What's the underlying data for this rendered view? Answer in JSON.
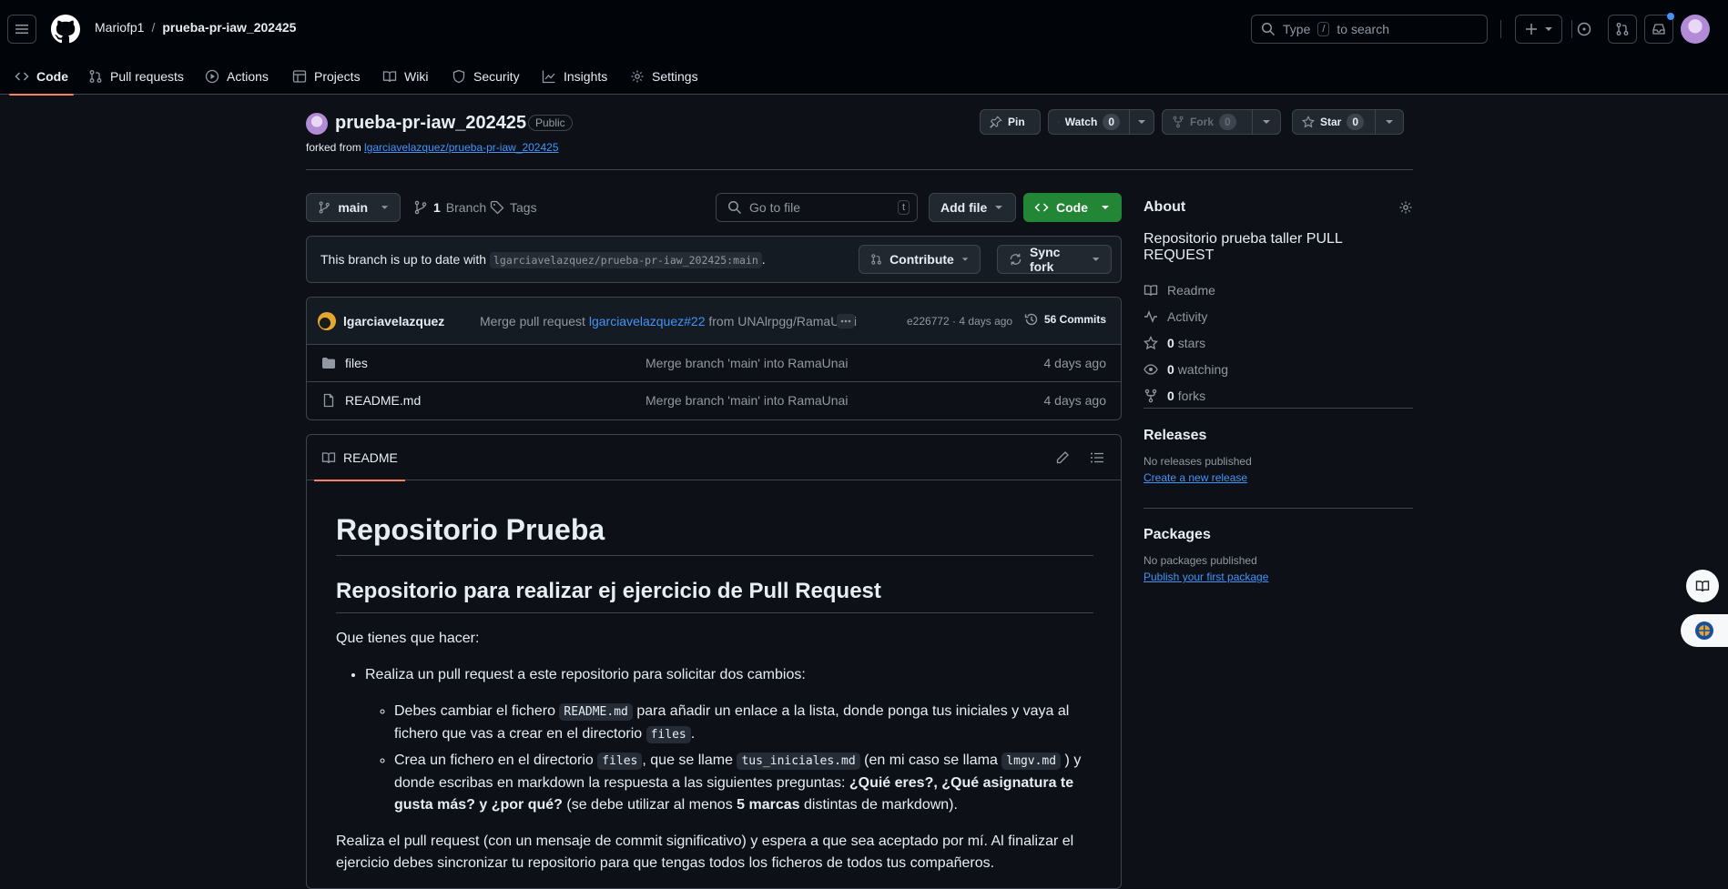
{
  "header": {
    "owner": "Mariofp1",
    "separator": "/",
    "repo": "prueba-pr-iaw_202425",
    "search_prefix": "Type",
    "search_key": "/",
    "search_suffix": "to search"
  },
  "nav": {
    "tabs": [
      {
        "label": "Code"
      },
      {
        "label": "Pull requests"
      },
      {
        "label": "Actions"
      },
      {
        "label": "Projects"
      },
      {
        "label": "Wiki"
      },
      {
        "label": "Security"
      },
      {
        "label": "Insights"
      },
      {
        "label": "Settings"
      }
    ]
  },
  "repo": {
    "title": "prueba-pr-iaw_202425",
    "visibility": "Public",
    "forked_prefix": "forked from",
    "forked_link": "lgarciavelazquez/prueba-pr-iaw_202425",
    "pin_label": "Pin",
    "watch_label": "Watch",
    "watch_count": "0",
    "fork_label": "Fork",
    "fork_count": "0",
    "star_label": "Star",
    "star_count": "0"
  },
  "filebar": {
    "branch": "main",
    "branch_count": "1",
    "branch_label": "Branch",
    "tags_label": "Tags",
    "goto_placeholder": "Go to file",
    "goto_key": "t",
    "add_file": "Add file",
    "code": "Code"
  },
  "uptodate": {
    "text": "This branch is up to date with",
    "ref": "lgarciavelazquez/prueba-pr-iaw_202425:main",
    "period": ".",
    "contribute": "Contribute",
    "sync": "Sync fork"
  },
  "commit": {
    "author": "lgarciavelazquez",
    "message_prefix": "Merge pull request",
    "pr_link": "lgarciavelazquez#22",
    "message_suffix": "from UNAlrpgg/RamaUnai",
    "hash_time": "e226772 · 4 days ago",
    "commits": "56 Commits"
  },
  "files": [
    {
      "name": "files",
      "message": "Merge branch 'main' into RamaUnai",
      "time": "4 days ago"
    },
    {
      "name": "README.md",
      "message": "Merge branch 'main' into RamaUnai",
      "time": "4 days ago"
    }
  ],
  "readme": {
    "tab": "README",
    "h1": "Repositorio Prueba",
    "h2": "Repositorio para realizar ej ejercicio de Pull Request",
    "intro": "Que tienes que hacer:",
    "bullet1": "Realiza un pull request a este repositorio para solicitar dos cambios:",
    "sub1_a": "Debes cambiar el fichero",
    "sub1_code1": "README.md",
    "sub1_b": "para añadir un enlace a la lista, donde ponga tus iniciales y vaya al fichero que vas a crear en el directorio",
    "sub1_code2": "files",
    "sub1_c": ".",
    "sub2_a": "Crea un fichero en el directorio",
    "sub2_code1": "files",
    "sub2_b": ", que se llame",
    "sub2_code2": "tus_iniciales.md",
    "sub2_c": "(en mi caso se llama",
    "sub2_code3": "lmgv.md",
    "sub2_d": ") y donde escribas en markdown la respuesta a las siguientes preguntas:",
    "sub2_bold1": "¿Quié eres?, ¿Qué asignatura te gusta más? y ¿por qué?",
    "sub2_e": "(se debe utilizar al menos",
    "sub2_bold2": "5 marcas",
    "sub2_f": "distintas de markdown).",
    "final": "Realiza el pull request (con un mensaje de commit significativo) y espera a que sea aceptado por mí. Al finalizar el ejercicio debes sincronizar tu repositorio para que tengas todos los ficheros de todos tus compañeros."
  },
  "sidebar": {
    "about": "About",
    "description": "Repositorio prueba taller PULL REQUEST",
    "readme": "Readme",
    "activity": "Activity",
    "stars_count": "0",
    "stars": "stars",
    "watching_count": "0",
    "watching": "watching",
    "forks_count": "0",
    "forks": "forks",
    "releases": "Releases",
    "no_releases": "No releases published",
    "create_release": "Create a new release",
    "packages": "Packages",
    "no_packages": "No packages published",
    "publish_package": "Publish your first package"
  },
  "colors": {
    "background": "#0d1117",
    "header": "#010409",
    "border": "#3d444d",
    "accent_blue": "#4493f8",
    "green_button": "#238636",
    "active_tab": "#f78166"
  }
}
